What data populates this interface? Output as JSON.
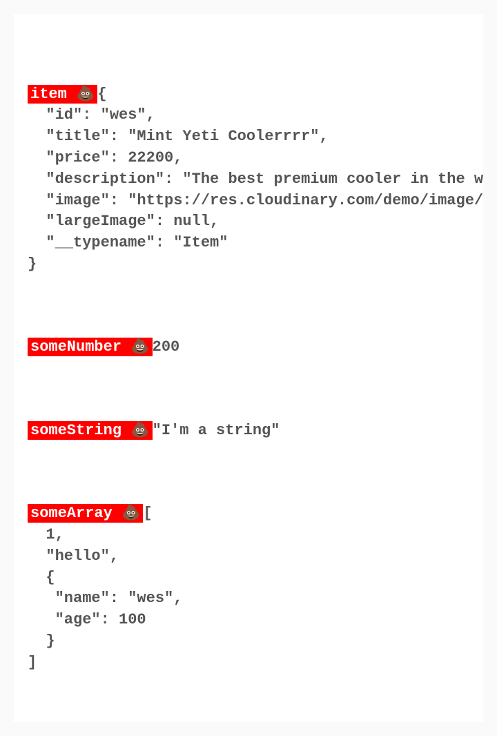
{
  "blocks": [
    {
      "label": "item 💩",
      "content": "{\n  \"id\": \"wes\",\n  \"title\": \"Mint Yeti Coolerrrr\",\n  \"price\": 22200,\n  \"description\": \"The best premium cooler in the world\",\n  \"image\": \"https://res.cloudinary.com/demo/image/upload\",\n  \"largeImage\": null,\n  \"__typename\": \"Item\"\n}"
    },
    {
      "label": "someNumber 💩",
      "content": "200"
    },
    {
      "label": "someString 💩",
      "content": "\"I'm a string\""
    },
    {
      "label": "someArray 💩",
      "content": "[\n  1,\n  \"hello\",\n  {\n   \"name\": \"wes\",\n   \"age\": 100\n  }\n]"
    }
  ]
}
